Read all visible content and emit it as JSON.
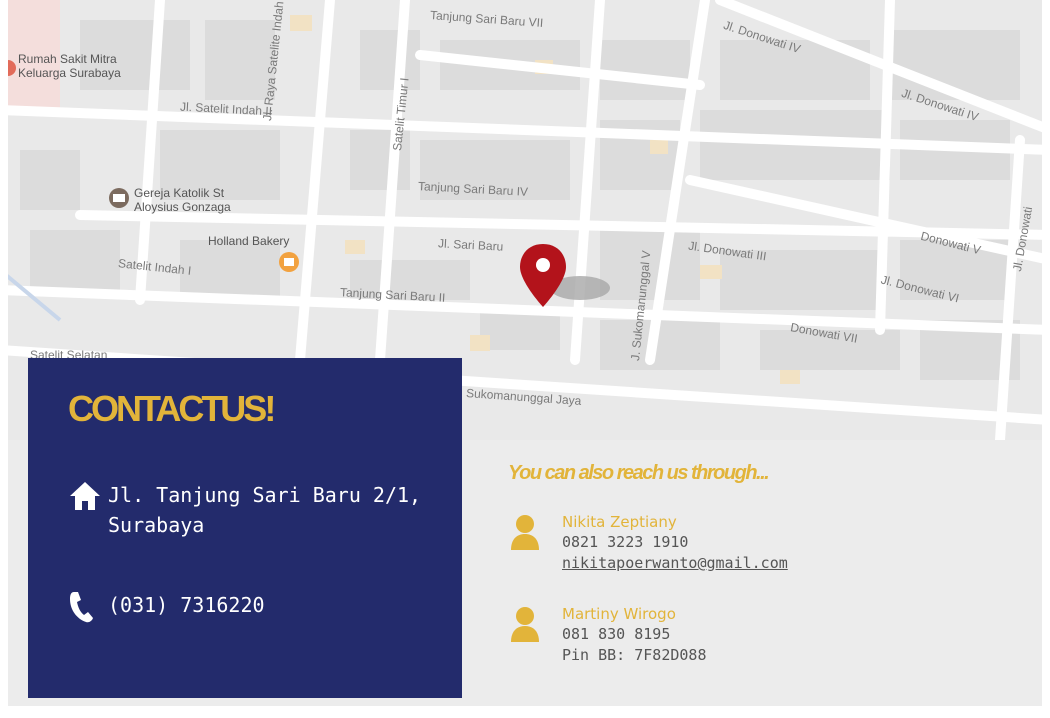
{
  "map": {
    "poi": [
      {
        "label": "Rumah Sakit Mitra\nKeluarga Surabaya",
        "icon": "hospital-icon"
      },
      {
        "label": "Gereja Katolik St\nAloysius Gonzaga",
        "icon": "church-icon"
      },
      {
        "label": "Holland Bakery",
        "icon": "bakery-icon"
      }
    ],
    "streets": [
      "Tanjung Sari Baru VII",
      "Jl. Donowati IV",
      "Jl. Donowati IV",
      "Jl. Raya Satelite Indah",
      "Satelit Timur I",
      "Jl. Satelit Indah II",
      "Tanjung Sari Baru IV",
      "Jl. Sari Baru",
      "Jl. Donowati III",
      "Donowati V",
      "Jl. Donowati",
      "Satelit Indah I",
      "Tanjung Sari Baru II",
      "J. Sukomanunggal V",
      "Jl. Donowati VI",
      "Donowati VII",
      "Sukomanunggal Jaya",
      "Satelit Selatan"
    ],
    "marker_icon": "map-pin-icon"
  },
  "contact": {
    "title": "CONTACTUS!",
    "address_icon": "home-icon",
    "address_line1": "Jl. Tanjung Sari Baru 2/1,",
    "address_line2": "Surabaya",
    "phone_icon": "phone-icon",
    "phone": "(031) 7316220"
  },
  "reach": {
    "title": "You can also reach us through...",
    "people": [
      {
        "name": "Nikita Zeptiany",
        "line1": "0821 3223 1910",
        "line2": "nikitapoerwanto@gmail.com",
        "icon": "person-icon"
      },
      {
        "name": "Martiny Wirogo",
        "line1": "081 830 8195",
        "line2": "Pin BB: 7F82D088",
        "icon": "person-icon"
      }
    ]
  },
  "colors": {
    "card_bg": "#232b6c",
    "accent": "#e2b43a",
    "marker": "#b3131b"
  }
}
